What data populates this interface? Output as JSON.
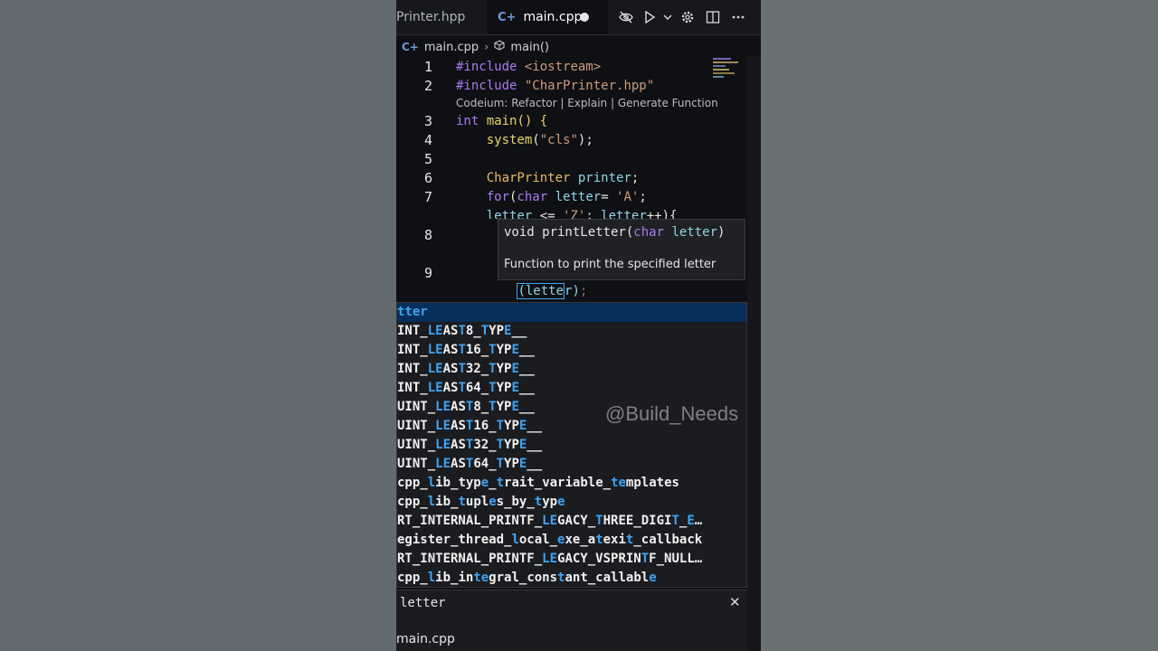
{
  "tabs": [
    {
      "label": "Printer.hpp",
      "active": false
    },
    {
      "label": "main.cpp",
      "active": true,
      "dirty": true
    }
  ],
  "tab_actions": [
    "eye-off-icon",
    "play-icon",
    "chevron-down-icon",
    "gear-icon",
    "split-editor-icon",
    "more-icon"
  ],
  "breadcrumb": {
    "file": "main.cpp",
    "symbol": "main()"
  },
  "codelens": "Codeium: Refactor | Explain | Generate Function",
  "line_numbers": [
    "1",
    "2",
    "3",
    "4",
    "5",
    "6",
    "7",
    "8",
    "9"
  ],
  "hover": {
    "signature_prefix": "void printLetter(",
    "signature_type": "char",
    "signature_param": "letter",
    "signature_suffix": ")",
    "doc": "Function to print the specified letter"
  },
  "suggest_items": [
    "tter",
    "INT_LEAST8_TYPE__",
    "INT_LEAST16_TYPE__",
    "INT_LEAST32_TYPE__",
    "INT_LEAST64_TYPE__",
    "UINT_LEAST8_TYPE__",
    "UINT_LEAST16_TYPE__",
    "UINT_LEAST32_TYPE__",
    "UINT_LEAST64_TYPE__",
    "cpp_lib_type_trait_variable_templates",
    "cpp_lib_tuples_by_type",
    "RT_INTERNAL_PRINTF_LEGACY_THREE_DIGIT_E…",
    "egister_thread_local_exe_atexit_callback",
    "RT_INTERNAL_PRINTF_LEGACY_VSPRINTF_NULL…",
    "cpp_lib_integral_constant_callable"
  ],
  "detail": {
    "signature": "letter",
    "file": "main.cpp"
  },
  "watermark": "@Build_Needs",
  "colors": {
    "accent": "#3ea4f5",
    "selection": "#062f5a",
    "keyword": "#a97bf0"
  }
}
